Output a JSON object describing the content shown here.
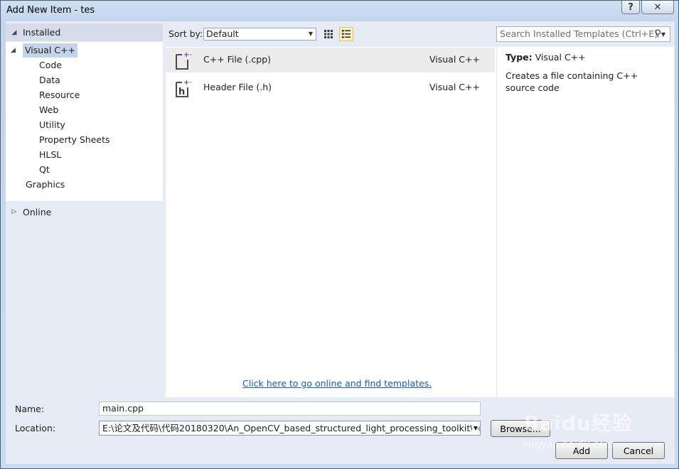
{
  "window": {
    "title": "Add New Item - tes",
    "help_label": "?",
    "close_label": "✕"
  },
  "tree": {
    "installed_label": "Installed",
    "selected": "Visual C++",
    "children": [
      "Code",
      "Data",
      "Resource",
      "Web",
      "Utility",
      "Property Sheets",
      "HLSL",
      "Qt"
    ],
    "graphics_label": "Graphics",
    "online_label": "Online"
  },
  "toolbar": {
    "sort_label": "Sort by:",
    "sort_value": "Default",
    "search_placeholder": "Search Installed Templates (Ctrl+E)",
    "icons": {
      "grid_view": "small-icons-view-icon",
      "list_view": "details-view-icon",
      "search": "magnifier-icon"
    }
  },
  "templates": [
    {
      "name": "C++ File (.cpp)",
      "language": "Visual C++",
      "icon": "cpp-file-icon",
      "selected": true
    },
    {
      "name": "Header File (.h)",
      "language": "Visual C++",
      "icon": "header-file-icon",
      "selected": false
    }
  ],
  "online_link": "Click here to go online and find templates.",
  "details": {
    "type_label": "Type:",
    "type_value": "Visual C++",
    "description": "Creates a file containing C++ source code"
  },
  "form": {
    "name_label": "Name:",
    "name_value": "main.cpp",
    "location_label": "Location:",
    "location_value": "E:\\论文及代码\\代码20180320\\An_OpenCV_based_structured_light_processing_toolkit\\projec",
    "browse_label": "Browse...",
    "add_label": "Add",
    "cancel_label": "Cancel"
  },
  "watermark": {
    "logo": "Baidu经验",
    "sub": "jingyan.baidu.com"
  },
  "colors": {
    "link": "#1a59b8",
    "selection": "#c6d4ea",
    "accent_plus": "#8a3d8a"
  }
}
